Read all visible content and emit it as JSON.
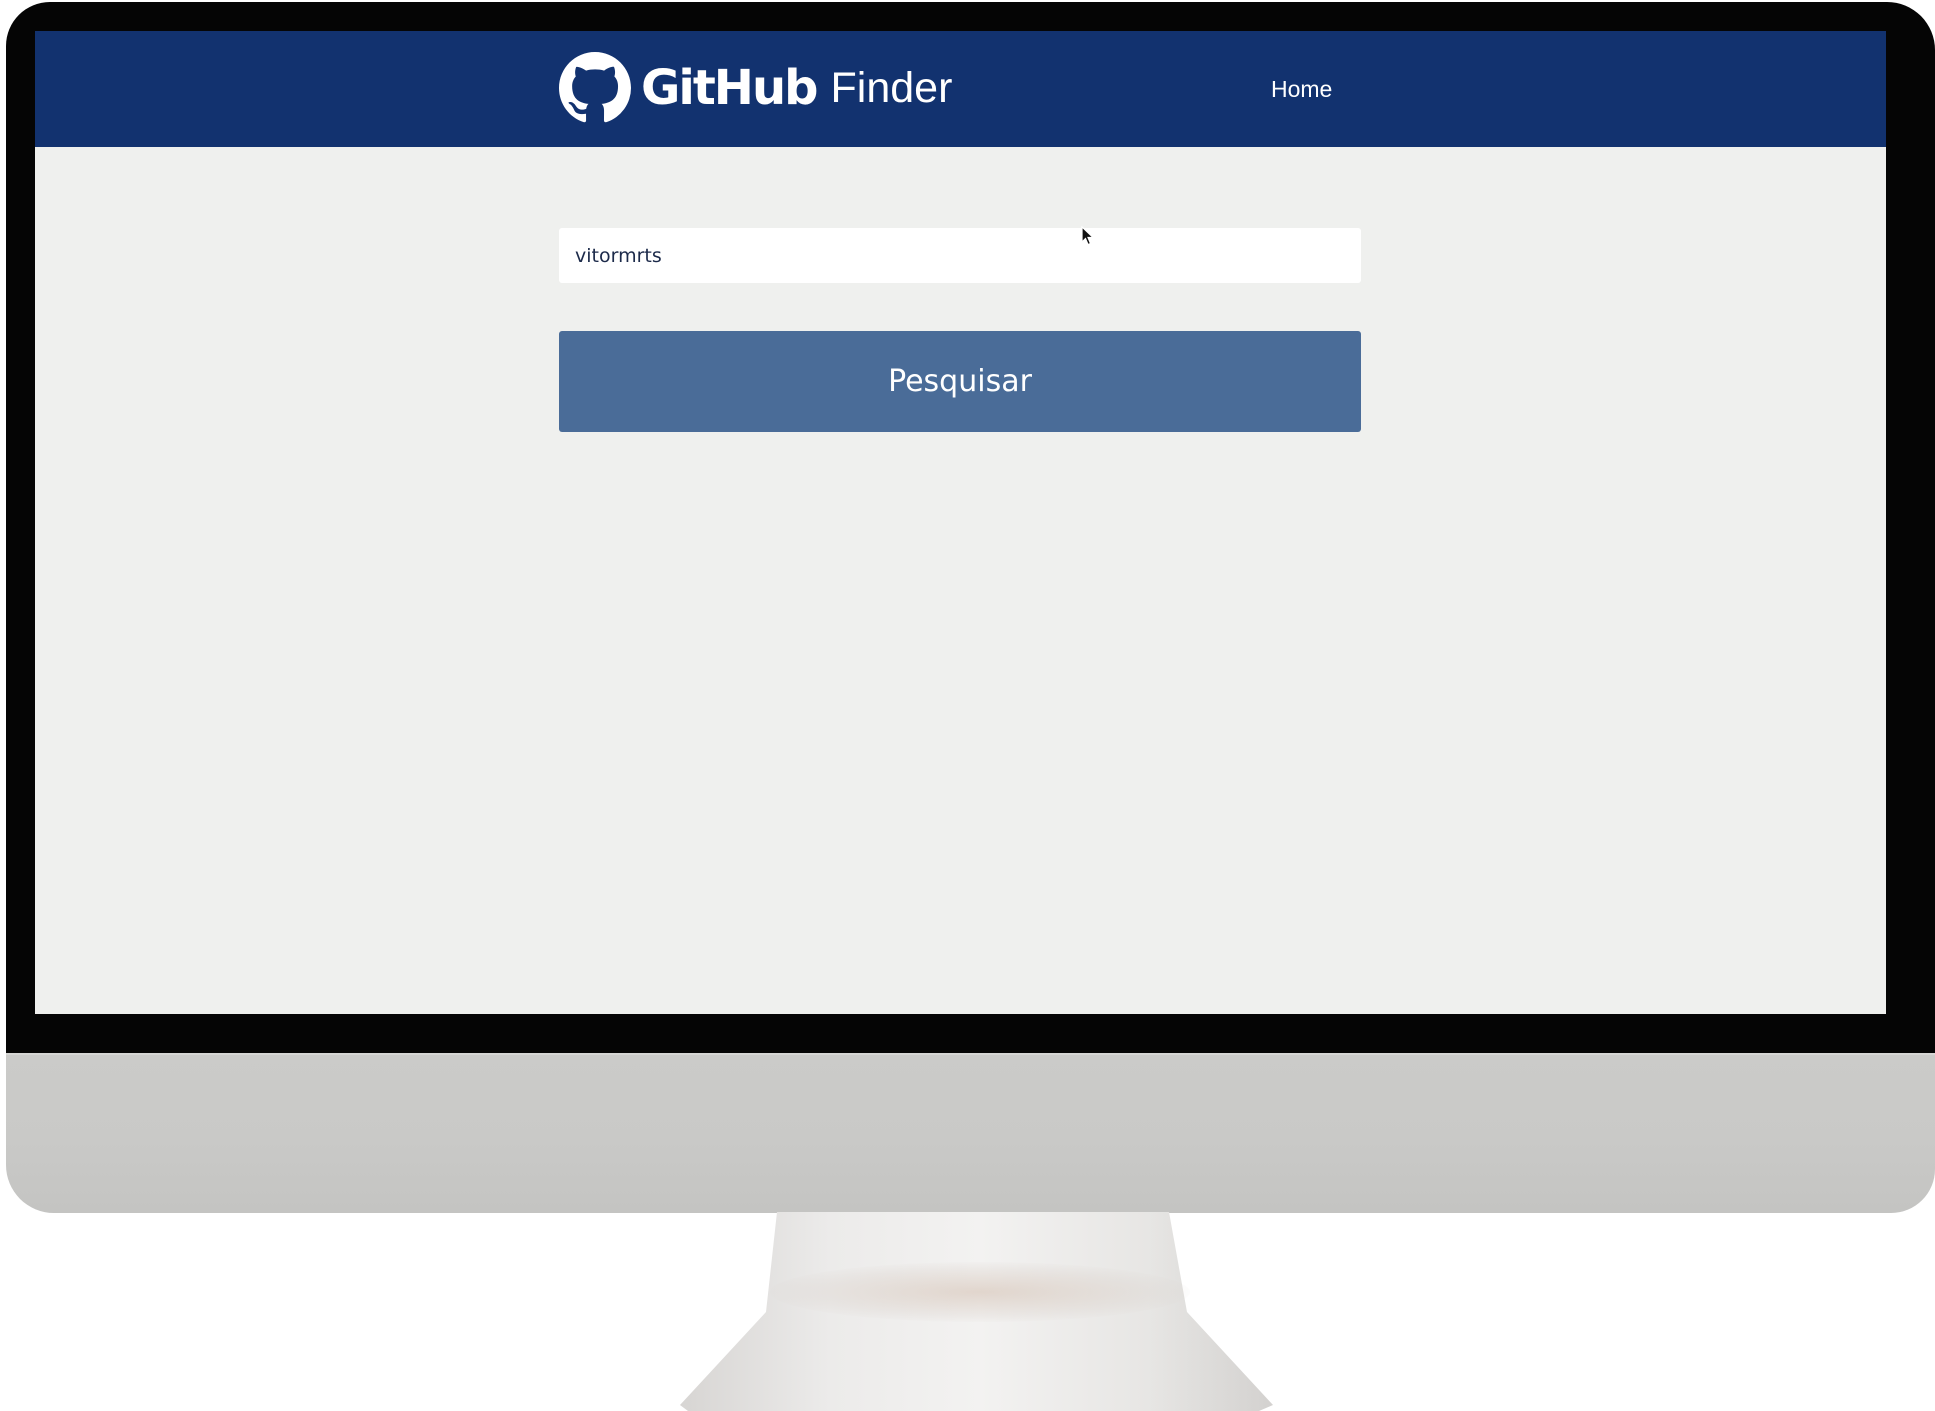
{
  "header": {
    "logo_icon": "github-octocat-icon",
    "brand_bold": "GitHub",
    "brand_light": "Finder",
    "nav_home": "Home"
  },
  "search": {
    "value": "vitormrts",
    "button_label": "Pesquisar"
  },
  "colors": {
    "navbar": "#12326f",
    "page_background": "#eff0ee",
    "button": "#4a6c98",
    "input_background": "#ffffff",
    "text_on_dark": "#ffffff"
  }
}
